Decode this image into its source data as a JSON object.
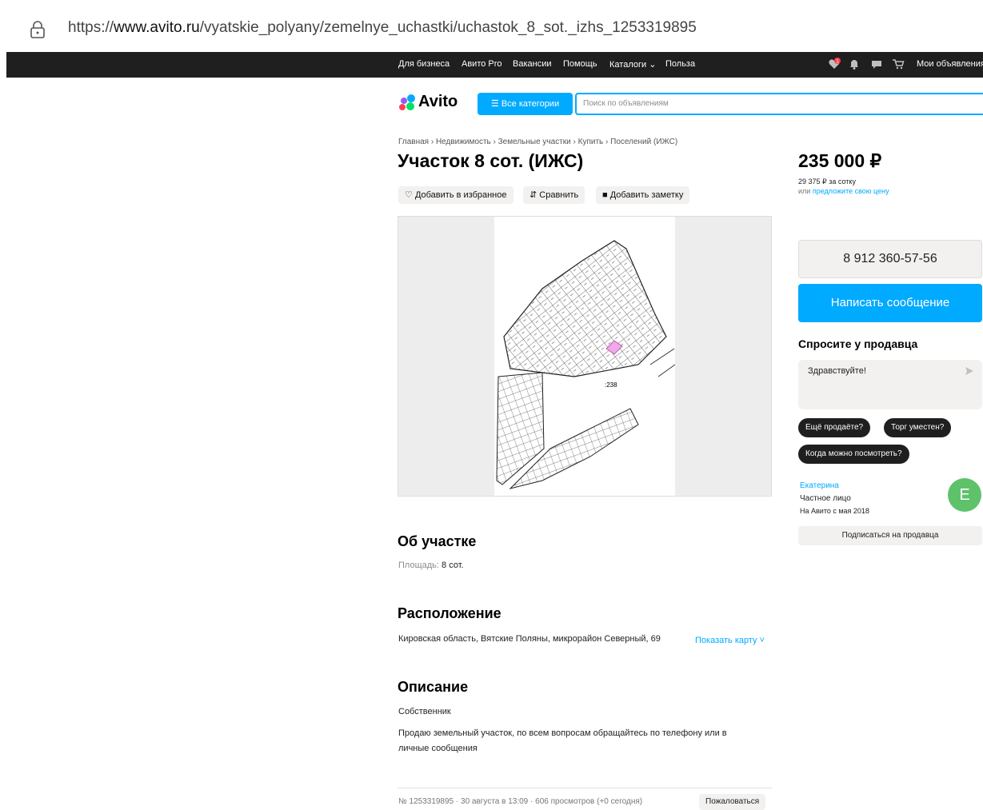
{
  "browser": {
    "url_prefix": "https://",
    "url_domain": "www.avito.ru",
    "url_path": "/vyatskie_polyany/zemelnye_uchastki/uchastok_8_sot._izhs_1253319895"
  },
  "topnav": {
    "links": [
      "Для бизнеса",
      "Авито Pro",
      "Вакансии",
      "Помощь",
      "Каталоги ⌄",
      "Польза"
    ],
    "my_ads": "Мои объявления",
    "notification_badge": "1"
  },
  "header": {
    "logo": "Avito",
    "categories_button": "Все категории",
    "search_placeholder": "Поиск по объявлениям"
  },
  "breadcrumbs": "Главная › Недвижимость › Земельные участки › Купить › Поселений (ИЖС)",
  "listing": {
    "title": "Участок 8 сот. (ИЖС)",
    "actions": {
      "favorite": "Добавить в избранное",
      "compare": "Сравнить",
      "note": "Добавить заметку"
    },
    "plot_label": ":238",
    "about": {
      "heading": "Об участке",
      "area_label": "Площадь:",
      "area_value": "8 сот."
    },
    "location": {
      "heading": "Расположение",
      "address": "Кировская область, Вятские Поляны, микрорайон Северный, 69",
      "show_map": "Показать карту ˅"
    },
    "description": {
      "heading": "Описание",
      "line1": "Собственник",
      "line2": "Продаю земельный участок, по всем вопросам обращайтесь по телефону или в",
      "line3": "личные сообщения"
    },
    "footer_meta": "№ 1253319895 · 30 августа в 13:09 · 606 просмотров (+0 сегодня)",
    "complain": "Пожаловаться"
  },
  "sidebar": {
    "price": "235 000 ₽",
    "price_per": "29 375 ₽ за сотку",
    "offer_prefix": "или",
    "offer_link": "предложите свою цену",
    "phone": "8 912 360-57-56",
    "write_message": "Написать сообщение",
    "ask_heading": "Спросите у продавца",
    "ask_text": "Здравствуйте!",
    "chips": [
      "Ещё продаёте?",
      "Торг уместен?",
      "Когда можно посмотреть?"
    ],
    "seller_name": "Екатерина",
    "seller_type": "Частное лицо",
    "seller_since": "На Авито с мая 2018",
    "avatar_letter": "Е",
    "subscribe": "Подписаться на продавца"
  },
  "colors": {
    "accent": "#00aaff",
    "topnav_bg": "#1f1f1f",
    "chip_bg": "#1f1f1f",
    "avatar_bg": "#5ec26a",
    "plot_highlight": "#f0a8e8"
  }
}
